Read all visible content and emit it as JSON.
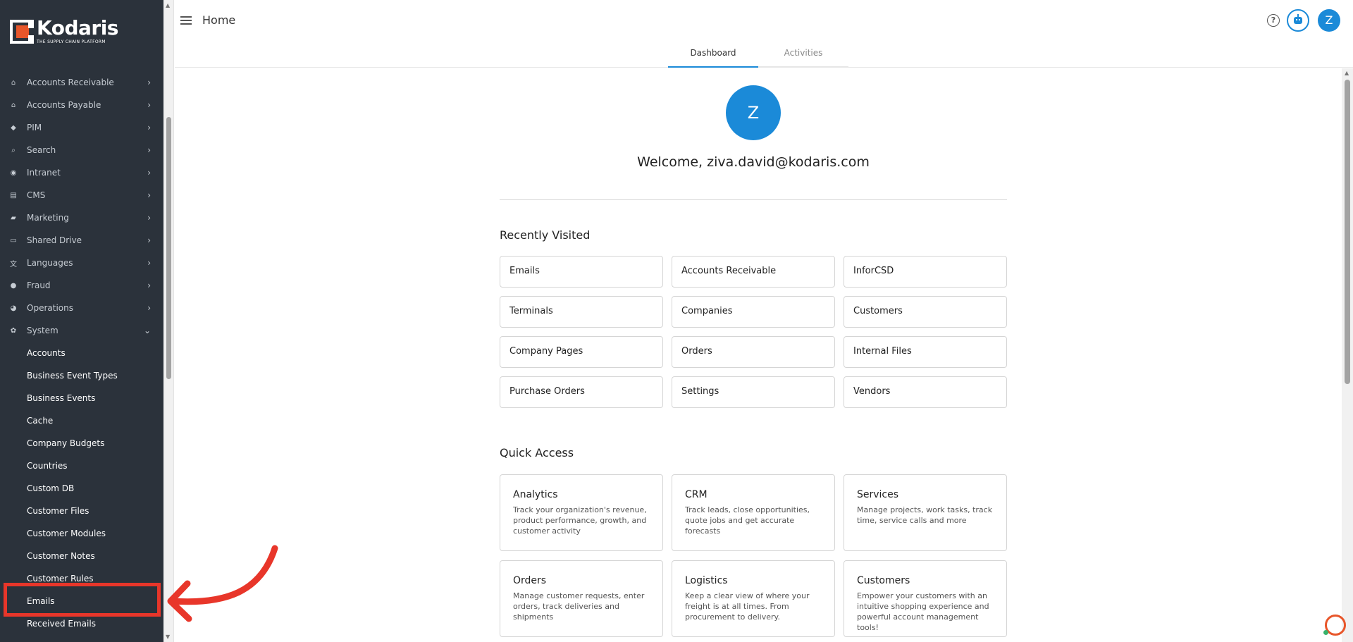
{
  "brand": {
    "name": "Kodaris",
    "tagline": "THE SUPPLY CHAIN PLATFORM"
  },
  "sidebar": {
    "items": [
      {
        "label": "Accounts Receivable",
        "icon": "bank-icon"
      },
      {
        "label": "Accounts Payable",
        "icon": "bank-icon"
      },
      {
        "label": "PIM",
        "icon": "tag-icon"
      },
      {
        "label": "Search",
        "icon": "search-icon"
      },
      {
        "label": "Intranet",
        "icon": "globe-icon"
      },
      {
        "label": "CMS",
        "icon": "layout-icon"
      },
      {
        "label": "Marketing",
        "icon": "megaphone-icon"
      },
      {
        "label": "Shared Drive",
        "icon": "folder-icon"
      },
      {
        "label": "Languages",
        "icon": "translate-icon"
      },
      {
        "label": "Fraud",
        "icon": "alert-icon"
      },
      {
        "label": "Operations",
        "icon": "palette-icon"
      },
      {
        "label": "System",
        "icon": "gear-icon"
      }
    ],
    "system_items": [
      "Accounts",
      "Business Event Types",
      "Business Events",
      "Cache",
      "Company Budgets",
      "Countries",
      "Custom DB",
      "Customer Files",
      "Customer Modules",
      "Customer Notes",
      "Customer Rules",
      "Emails",
      "Received Emails"
    ]
  },
  "header": {
    "title": "Home",
    "user_initial": "Z"
  },
  "tabs": [
    "Dashboard",
    "Activities"
  ],
  "main": {
    "user_initial": "Z",
    "welcome": "Welcome, ziva.david@kodaris.com",
    "recently_visited_title": "Recently Visited",
    "recently_visited": [
      "Emails",
      "Accounts Receivable",
      "InforCSD",
      "Terminals",
      "Companies",
      "Customers",
      "Company Pages",
      "Orders",
      "Internal Files",
      "Purchase Orders",
      "Settings",
      "Vendors"
    ],
    "quick_access_title": "Quick Access",
    "quick_access": [
      {
        "title": "Analytics",
        "desc": "Track your organization's revenue, product performance, growth, and customer activity"
      },
      {
        "title": "CRM",
        "desc": "Track leads, close opportunities, quote jobs and get accurate forecasts"
      },
      {
        "title": "Services",
        "desc": "Manage projects, work tasks, track time, service calls and more"
      },
      {
        "title": "Orders",
        "desc": "Manage customer requests, enter orders, track deliveries and shipments"
      },
      {
        "title": "Logistics",
        "desc": "Keep a clear view of where your freight is at all times. From procurement to delivery."
      },
      {
        "title": "Customers",
        "desc": "Empower your customers with an intuitive shopping experience and powerful account management tools!"
      }
    ]
  },
  "colors": {
    "sidebar_bg": "#2b323b",
    "accent": "#1b8ad8",
    "brand_orange": "#e8562a",
    "annotation_red": "#e8362a"
  }
}
